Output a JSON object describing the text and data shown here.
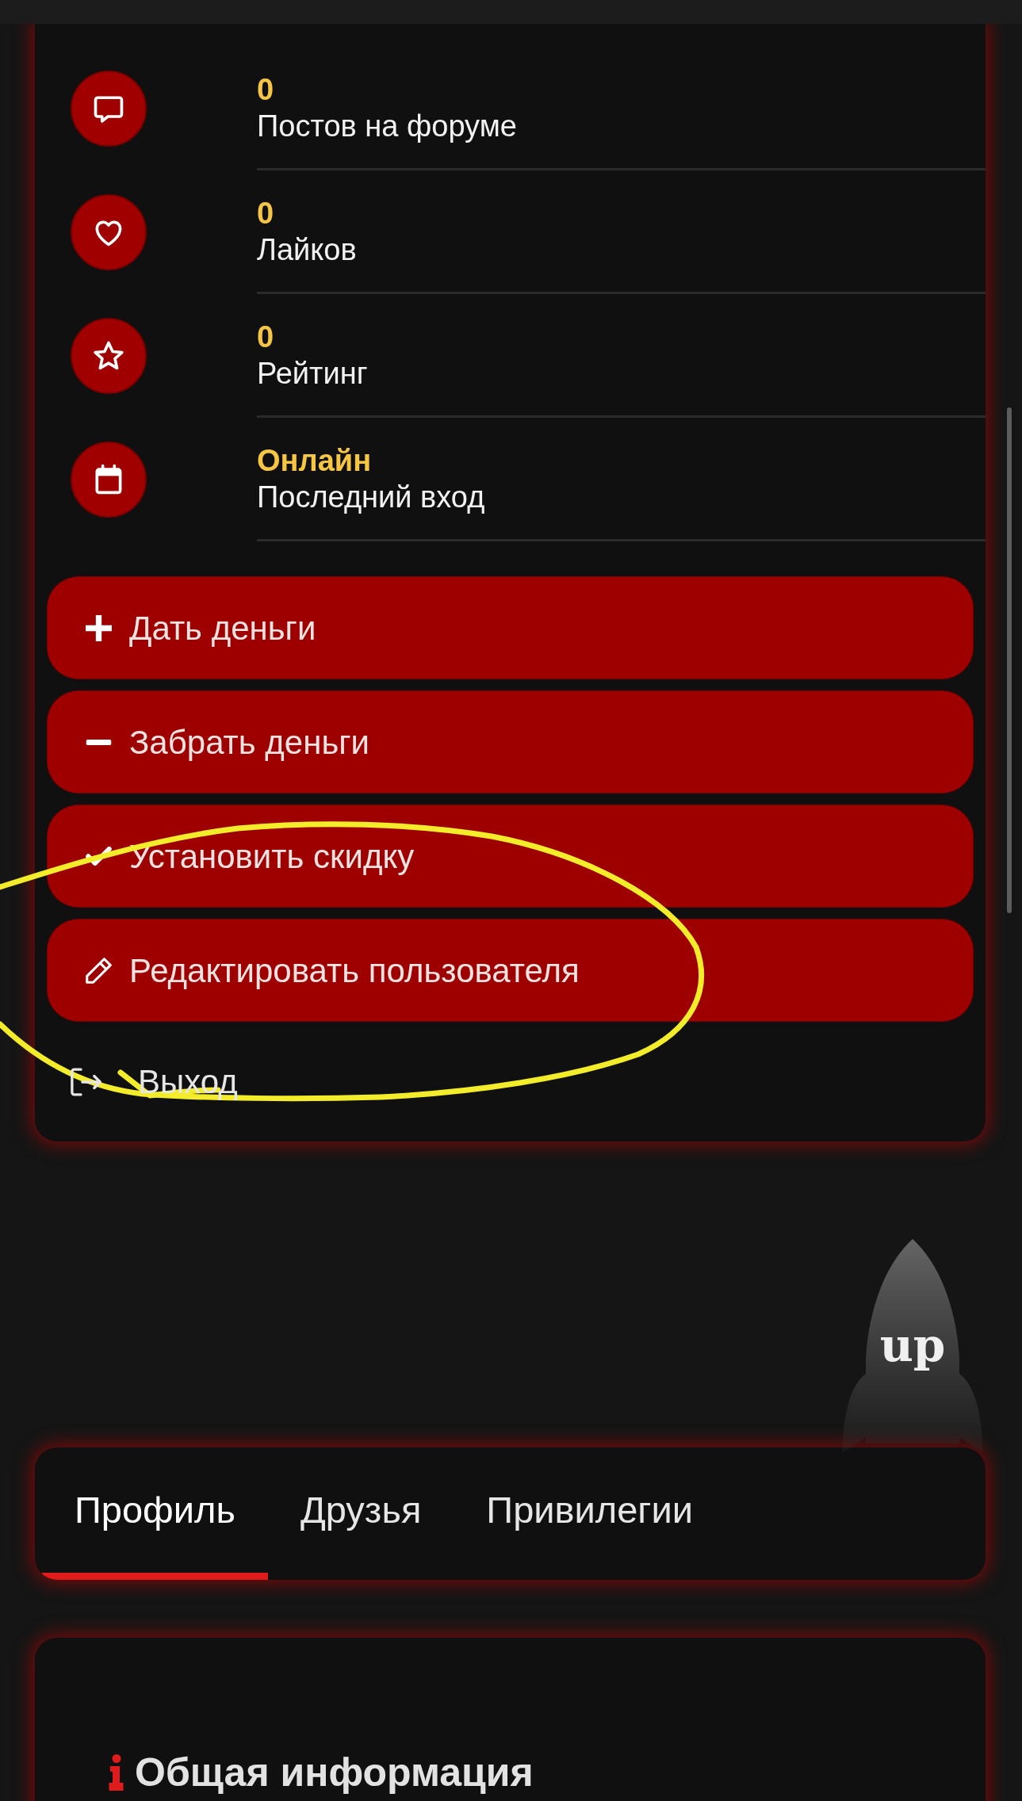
{
  "stats": [
    {
      "value": "0",
      "label": "Постов на форуме"
    },
    {
      "value": "0",
      "label": "Лайков"
    },
    {
      "value": "0",
      "label": "Рейтинг"
    },
    {
      "value": "Онлайн",
      "label": "Последний вход"
    }
  ],
  "actions": [
    {
      "label": "Дать деньги"
    },
    {
      "label": "Забрать деньги"
    },
    {
      "label": "Установить скидку"
    },
    {
      "label": "Редактировать пользователя"
    }
  ],
  "logout": {
    "label": "Выход"
  },
  "scroll_top_button": {
    "label": "up"
  },
  "tabs": [
    {
      "label": "Профиль",
      "selected": true
    },
    {
      "label": "Друзья",
      "selected": false
    },
    {
      "label": "Привилегии",
      "selected": false
    }
  ],
  "section": {
    "title": "Общая информация"
  },
  "annotation": {
    "kind": "ellipse"
  }
}
